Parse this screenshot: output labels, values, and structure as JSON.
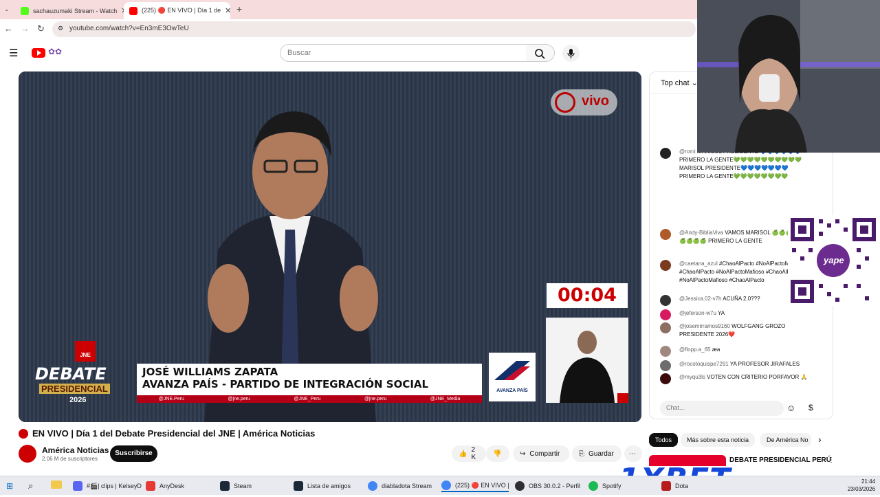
{
  "browser": {
    "tabs": [
      {
        "title": "sachauzumaki Stream - Watch",
        "active": false,
        "color": "#53fc18"
      },
      {
        "title": "(225) 🔴 EN VIVO | Día 1 de",
        "active": true,
        "color": "#ff0000"
      }
    ],
    "new_tab": "+",
    "url": "youtube.com/watch?v=En3mE3OwTeU"
  },
  "youtube": {
    "search_placeholder": "Buscar",
    "video": {
      "live_badge": "vivo",
      "timer": "00:04",
      "speaker_name": "JOSÉ WILLIAMS ZAPATA",
      "speaker_party": "AVANZA PAÍS - PARTIDO DE INTEGRACIÓN SOCIAL",
      "socials": [
        "@JNE.Peru",
        "@jne.peru",
        "@JNE_Peru",
        "@jne.peru",
        "@JNE_Media"
      ],
      "debate_label_1": "DEBATE",
      "debate_label_2": "PRESIDENCIAL",
      "debate_year": "2026",
      "jne": "JNE",
      "party_logo_text": "AVANZA PAÍS"
    },
    "title": "EN VIVO | Día 1 del Debate Presidencial del JNE | América Noticias",
    "channel": {
      "name": "América Noticias",
      "subscribers": "2.06 M de suscriptores",
      "subscribe_label": "Suscribirse"
    },
    "actions": {
      "likes": "2 K",
      "share": "Compartir",
      "save": "Guardar",
      "more": "⋯"
    },
    "chips": [
      "Todos",
      "Más sobre esta noticia",
      "De América No"
    ],
    "related_title": "DEBATE PRESIDENCIAL PERÚ"
  },
  "chat": {
    "header": "Top chat",
    "input_placeholder": "Chat...",
    "messages": [
      {
        "author": "@romi",
        "text": "MARISOL PRESIDENTE 💙💙💙💙💙💙 PRIMERO LA GENTE💚💚💚💚💚💚💚💚💚💚MARISOL PRESIDENTE💙💙💙💙💙💙💙 PRIMERO LA GENTE💚💚💚💚💚💚💚💚",
        "avatar": "#222222"
      },
      {
        "author": "@Andy-BibliaViva",
        "text": "VAMOS MARISOL 🍏🍏🍏🍏🍏🍏🍏🍏🍏 PRIMERO LA GENTE",
        "avatar": "#b05a2a"
      },
      {
        "author": "@caetana_azul",
        "text": "#ChaoAlPacto #NoAlPactoMafioso #ChaoAlPacto #NoAlPactoMafioso #ChaoAlPacto #NoAlPactoMafioso #ChaoAlPacto",
        "avatar": "#7a3b1e"
      },
      {
        "author": "@Jessica.02-v7h",
        "text": "ACUÑA 2.0???",
        "avatar": "#333333"
      },
      {
        "author": "@jeferson-w7u",
        "text": "YA",
        "avatar": "#d81b60"
      },
      {
        "author": "@josemirramos9160",
        "text": "WOLFGANG GROZO PRESIDENTE 2026❤️",
        "avatar": "#8d6e63"
      },
      {
        "author": "@flopp.a_65",
        "text": "æa",
        "avatar": "#a1887f"
      },
      {
        "author": "@rocotoquispe7291",
        "text": "YA PROFESOR JIRAFALES",
        "avatar": "#6d6d6d"
      },
      {
        "author": "@myqu3ls",
        "text": "VOTEN CON CRITERIO PORFAVOR 🙏",
        "avatar": "#3b0a0a"
      }
    ]
  },
  "overlay": {
    "qr_brand": "yape",
    "sponsor": "1XBET"
  },
  "taskbar": {
    "items": [
      {
        "label": "#🎬| clips | KelseyD...",
        "color": "#5865f2"
      },
      {
        "label": "AnyDesk",
        "color": "#e53935"
      },
      {
        "label": "Steam",
        "color": "#1b2838"
      },
      {
        "label": "Lista de amigos",
        "color": "#1b2838"
      },
      {
        "label": "diabladota Stream ...",
        "color": "#4285f4"
      },
      {
        "label": "(225) 🔴 EN VIVO | ...",
        "color": "#4285f4"
      },
      {
        "label": "OBS 30.0.2 - Perfil: ...",
        "color": "#302e31"
      },
      {
        "label": "Spotify",
        "color": "#1db954"
      },
      {
        "label": "Dota",
        "color": "#b71c1c"
      }
    ],
    "time": "21:44",
    "date": "23/03/2026"
  }
}
